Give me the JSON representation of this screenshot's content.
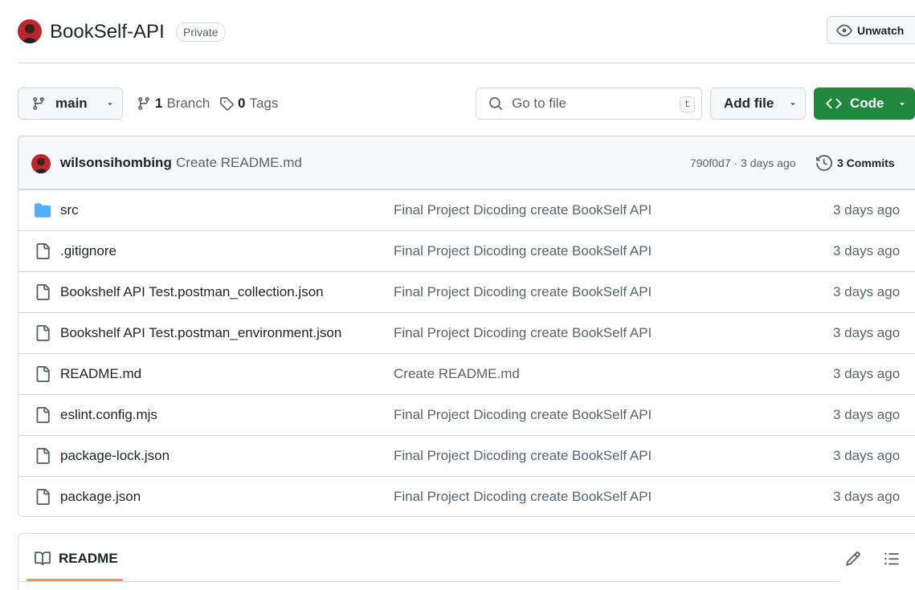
{
  "repo": {
    "name": "BookSelf-API",
    "visibility": "Private",
    "unwatch_label": "Unwatch"
  },
  "toolbar": {
    "branch": "main",
    "branch_count": "1",
    "branch_label": "Branch",
    "tag_count": "0",
    "tag_label": "Tags",
    "search_placeholder": "Go to file",
    "search_shortcut": "t",
    "add_file_label": "Add file",
    "code_label": "Code"
  },
  "latest_commit": {
    "author": "wilsonsihombing",
    "message": "Create README.md",
    "meta": "790f0d7 · 3 days ago",
    "commits_label": "3 Commits"
  },
  "files": [
    {
      "name": "src",
      "type": "folder",
      "commit": "Final Project Dicoding create BookSelf API",
      "age": "3 days ago"
    },
    {
      "name": ".gitignore",
      "type": "file",
      "commit": "Final Project Dicoding create BookSelf API",
      "age": "3 days ago"
    },
    {
      "name": "Bookshelf API Test.postman_collection.json",
      "type": "file",
      "commit": "Final Project Dicoding create BookSelf API",
      "age": "3 days ago"
    },
    {
      "name": "Bookshelf API Test.postman_environment.json",
      "type": "file",
      "commit": "Final Project Dicoding create BookSelf API",
      "age": "3 days ago"
    },
    {
      "name": "README.md",
      "type": "file",
      "commit": "Create README.md",
      "age": "3 days ago"
    },
    {
      "name": "eslint.config.mjs",
      "type": "file",
      "commit": "Final Project Dicoding create BookSelf API",
      "age": "3 days ago"
    },
    {
      "name": "package-lock.json",
      "type": "file",
      "commit": "Final Project Dicoding create BookSelf API",
      "age": "3 days ago"
    },
    {
      "name": "package.json",
      "type": "file",
      "commit": "Final Project Dicoding create BookSelf API",
      "age": "3 days ago"
    }
  ],
  "readme": {
    "tab_label": "README"
  },
  "icons": {
    "folder": "folder-icon",
    "file": "file-icon",
    "branch": "git-branch-icon",
    "tag": "tag-icon",
    "search": "search-icon",
    "eye": "eye-icon",
    "code": "code-icon",
    "history": "history-icon",
    "book": "book-icon",
    "pencil": "pencil-icon",
    "outline": "list-unordered-icon"
  },
  "colors": {
    "accent_green": "#1f883d",
    "folder_blue": "#54aeff",
    "border": "#d1d9e0",
    "muted_text": "#59636e",
    "readme_underline": "#fd8c73"
  }
}
